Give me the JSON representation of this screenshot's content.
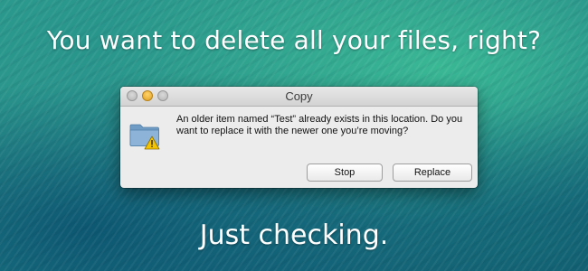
{
  "captions": {
    "headline": "You want to delete all your files, right?",
    "subline": "Just checking."
  },
  "dialog": {
    "title": "Copy",
    "message": "An older item named “Test” already exists in this location. Do you want to replace it with the newer one you’re moving?",
    "icon": "folder-warning-icon",
    "buttons": {
      "stop": "Stop",
      "replace": "Replace"
    },
    "traffic_lights": [
      "close",
      "minimize",
      "zoom"
    ]
  },
  "colors": {
    "minimize_light": "#e0a020",
    "folder": "#7fa6c9",
    "warning": "#f5c400"
  }
}
